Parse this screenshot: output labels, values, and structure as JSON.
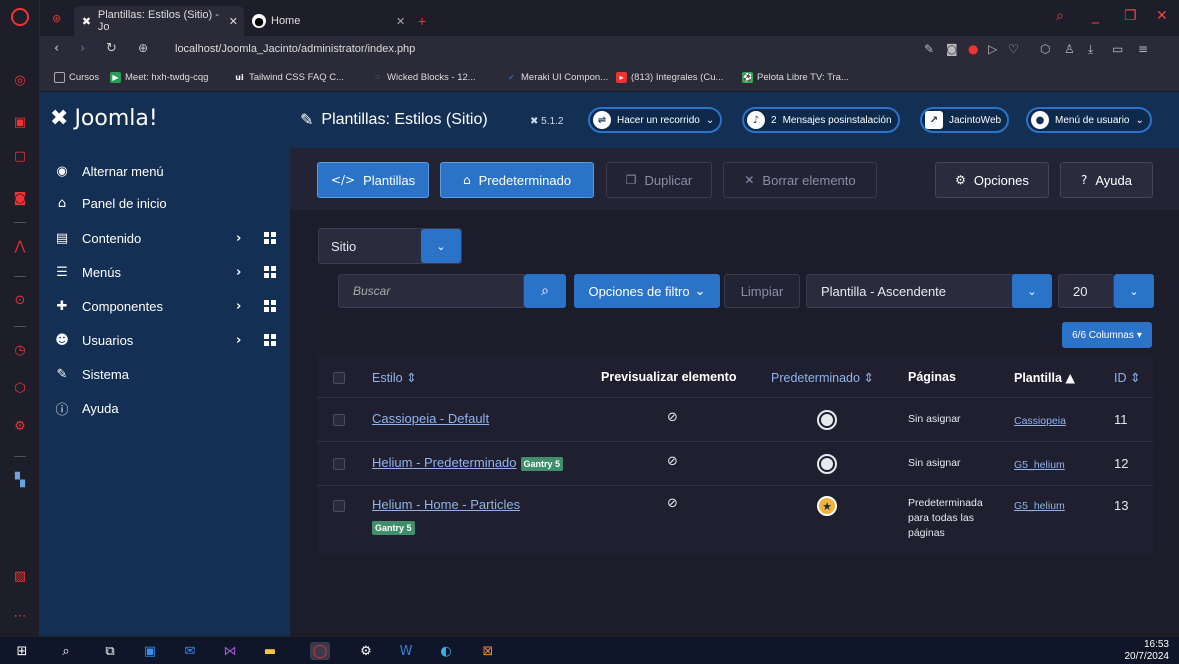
{
  "browser": {
    "tabs": [
      {
        "label": "Plantillas: Estilos (Sitio) - Jo",
        "favicon": "joomla-icon"
      },
      {
        "label": "Home",
        "favicon": "globe-icon"
      }
    ],
    "url": "localhost/Joomla_Jacinto/administrator/index.php",
    "bookmarks": [
      {
        "label": "Cursos",
        "icon": "folder-icon"
      },
      {
        "label": "Meet: hxh-twdg-cqg",
        "icon": "meet-icon"
      },
      {
        "label": "Tailwind CSS FAQ C...",
        "icon": "ui-icon"
      },
      {
        "label": "Wicked Blocks - 12...",
        "icon": "blocks-icon"
      },
      {
        "label": "Meraki UI Compon...",
        "icon": "meraki-icon"
      },
      {
        "label": "(813) Integrales (Cu...",
        "icon": "youtube-icon"
      },
      {
        "label": "Pelota Libre TV: Tra...",
        "icon": "ball-icon"
      }
    ]
  },
  "header": {
    "logo": "Joomla!",
    "page_title": "Plantillas: Estilos (Sitio)",
    "version": "5.1.2",
    "tour_label": "Hacer un recorrido",
    "messages_count": "2",
    "messages_label": "Mensajes posinstalación",
    "site_label": "JacintoWeb",
    "user_menu_label": "Menú de usuario"
  },
  "sidebar": {
    "items": [
      {
        "label": "Alternar menú",
        "icon": "toggle-icon"
      },
      {
        "label": "Panel de inicio",
        "icon": "home-icon"
      },
      {
        "label": "Contenido",
        "icon": "file-icon"
      },
      {
        "label": "Menús",
        "icon": "list-icon"
      },
      {
        "label": "Componentes",
        "icon": "puzzle-icon"
      },
      {
        "label": "Usuarios",
        "icon": "users-icon"
      },
      {
        "label": "Sistema",
        "icon": "wrench-icon"
      },
      {
        "label": "Ayuda",
        "icon": "info-icon"
      }
    ]
  },
  "toolbar": {
    "templates": "Plantillas",
    "default": "Predeterminado",
    "duplicate": "Duplicar",
    "delete": "Borrar elemento",
    "options": "Opciones",
    "help": "Ayuda"
  },
  "filters": {
    "client": "Sitio",
    "search_placeholder": "Buscar",
    "filter_options": "Opciones de filtro",
    "clear": "Limpiar",
    "ordering": "Plantilla - Ascendente",
    "limit": "20",
    "columns": "6/6 Columnas"
  },
  "table": {
    "headers": {
      "style": "Estilo",
      "preview": "Previsualizar elemento",
      "default": "Predeterminado",
      "pages": "Páginas",
      "template": "Plantilla",
      "id": "ID"
    },
    "rows": [
      {
        "style": "Cassiopeia - Default",
        "badge": "",
        "pages": "Sin asignar",
        "template": "Cassiopeia",
        "id": "11",
        "is_default": false
      },
      {
        "style": "Helium - Predeterminado",
        "badge": "Gantry 5",
        "pages": "Sin asignar",
        "template": "G5_helium",
        "id": "12",
        "is_default": false
      },
      {
        "style": "Helium - Home - Particles",
        "badge": "Gantry 5",
        "pages_lines": [
          "Predeterminada",
          "para todas las",
          "páginas"
        ],
        "template": "G5_helium",
        "id": "13",
        "is_default": true
      }
    ]
  },
  "taskbar": {
    "time": "16:53",
    "date": "20/7/2024"
  }
}
